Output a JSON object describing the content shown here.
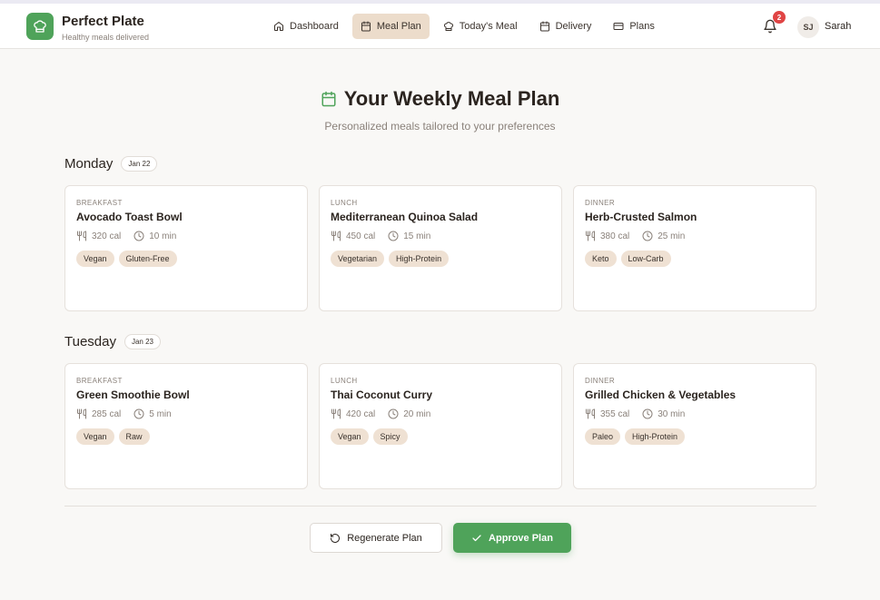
{
  "header": {
    "brand": "Perfect Plate",
    "tagline": "Healthy meals delivered",
    "nav": [
      {
        "label": "Dashboard",
        "icon": "home-icon",
        "active": false
      },
      {
        "label": "Meal Plan",
        "icon": "calendar-icon",
        "active": true
      },
      {
        "label": "Today's Meal",
        "icon": "chef-hat-icon",
        "active": false
      },
      {
        "label": "Delivery",
        "icon": "calendar-icon",
        "active": false
      },
      {
        "label": "Plans",
        "icon": "credit-card-icon",
        "active": false
      }
    ],
    "notifications": "2",
    "user_initials": "SJ",
    "user_name": "Sarah"
  },
  "page": {
    "title": "Your Weekly Meal Plan",
    "subtitle": "Personalized meals tailored to your preferences"
  },
  "days": [
    {
      "name": "Monday",
      "date": "Jan 22",
      "meals": [
        {
          "type": "BREAKFAST",
          "name": "Avocado Toast Bowl",
          "cal": "320 cal",
          "time": "10 min",
          "tags": [
            "Vegan",
            "Gluten-Free"
          ]
        },
        {
          "type": "LUNCH",
          "name": "Mediterranean Quinoa Salad",
          "cal": "450 cal",
          "time": "15 min",
          "tags": [
            "Vegetarian",
            "High-Protein"
          ]
        },
        {
          "type": "DINNER",
          "name": "Herb-Crusted Salmon",
          "cal": "380 cal",
          "time": "25 min",
          "tags": [
            "Keto",
            "Low-Carb"
          ]
        }
      ]
    },
    {
      "name": "Tuesday",
      "date": "Jan 23",
      "meals": [
        {
          "type": "BREAKFAST",
          "name": "Green Smoothie Bowl",
          "cal": "285 cal",
          "time": "5 min",
          "tags": [
            "Vegan",
            "Raw"
          ]
        },
        {
          "type": "LUNCH",
          "name": "Thai Coconut Curry",
          "cal": "420 cal",
          "time": "20 min",
          "tags": [
            "Vegan",
            "Spicy"
          ]
        },
        {
          "type": "DINNER",
          "name": "Grilled Chicken & Vegetables",
          "cal": "355 cal",
          "time": "30 min",
          "tags": [
            "Paleo",
            "High-Protein"
          ]
        }
      ]
    }
  ],
  "actions": {
    "regenerate": "Regenerate Plan",
    "approve": "Approve Plan"
  },
  "colors": {
    "accent": "#4fa35a",
    "nav_active": "#ecdccb",
    "tag_bg": "#efe1d3",
    "badge": "#e04444"
  }
}
